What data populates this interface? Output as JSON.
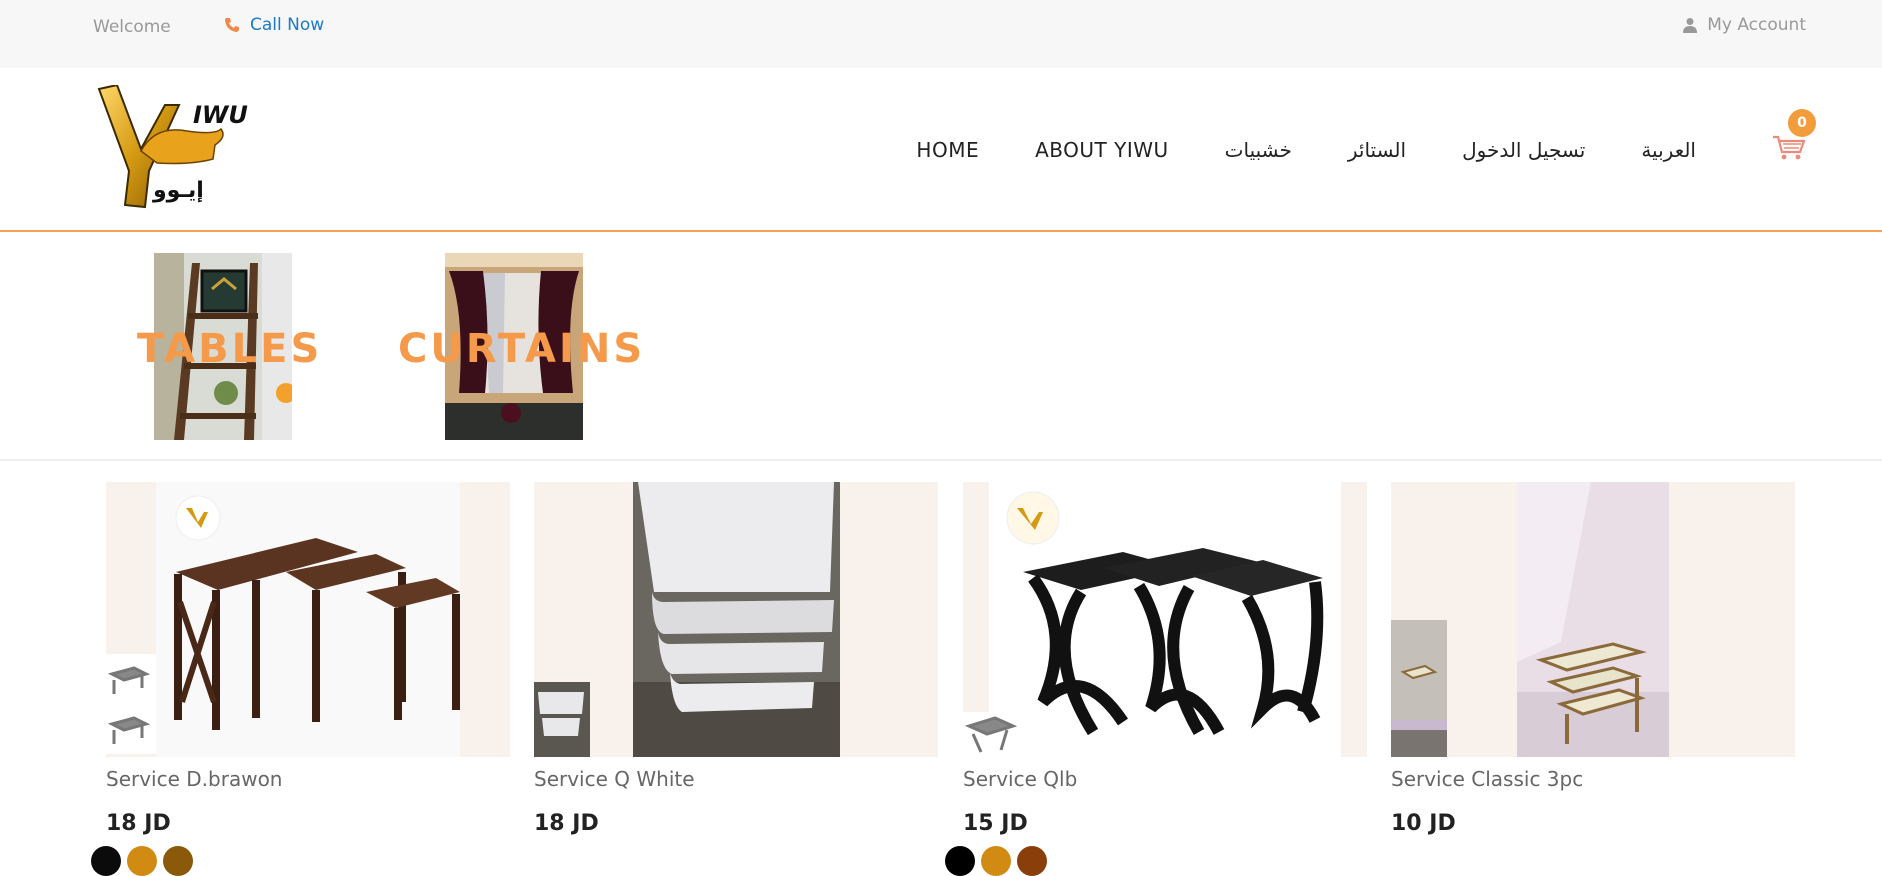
{
  "topbar": {
    "welcome": "Welcome",
    "call_now": "Call Now",
    "account": "My Account"
  },
  "header": {
    "logo_text_latin": "IWU",
    "logo_text_arabic": "إيـوو",
    "nav": [
      "HOME",
      "ABOUT YIWU",
      "خشبيات",
      "الستائر",
      "تسجيل الدخول",
      "العربية"
    ],
    "cart_count": "0"
  },
  "categories": [
    {
      "label": "TABLES"
    },
    {
      "label": "CURTAINS"
    }
  ],
  "products": [
    {
      "name": "Service D.brawon",
      "price": "18 JD",
      "colors": [
        "#0b0b0b",
        "#d18b12",
        "#8a5a0a"
      ]
    },
    {
      "name": "Service Q White",
      "price": "18 JD",
      "colors": []
    },
    {
      "name": "Service Qlb",
      "price": "15 JD",
      "colors": [
        "#000000",
        "#d18b12",
        "#8a3f0a"
      ]
    },
    {
      "name": "Service Classic 3pc",
      "price": "10 JD",
      "colors": []
    }
  ],
  "colors": {
    "accent": "#f59a4a",
    "link": "#1a7ac8",
    "badge": "#f39c3c"
  }
}
